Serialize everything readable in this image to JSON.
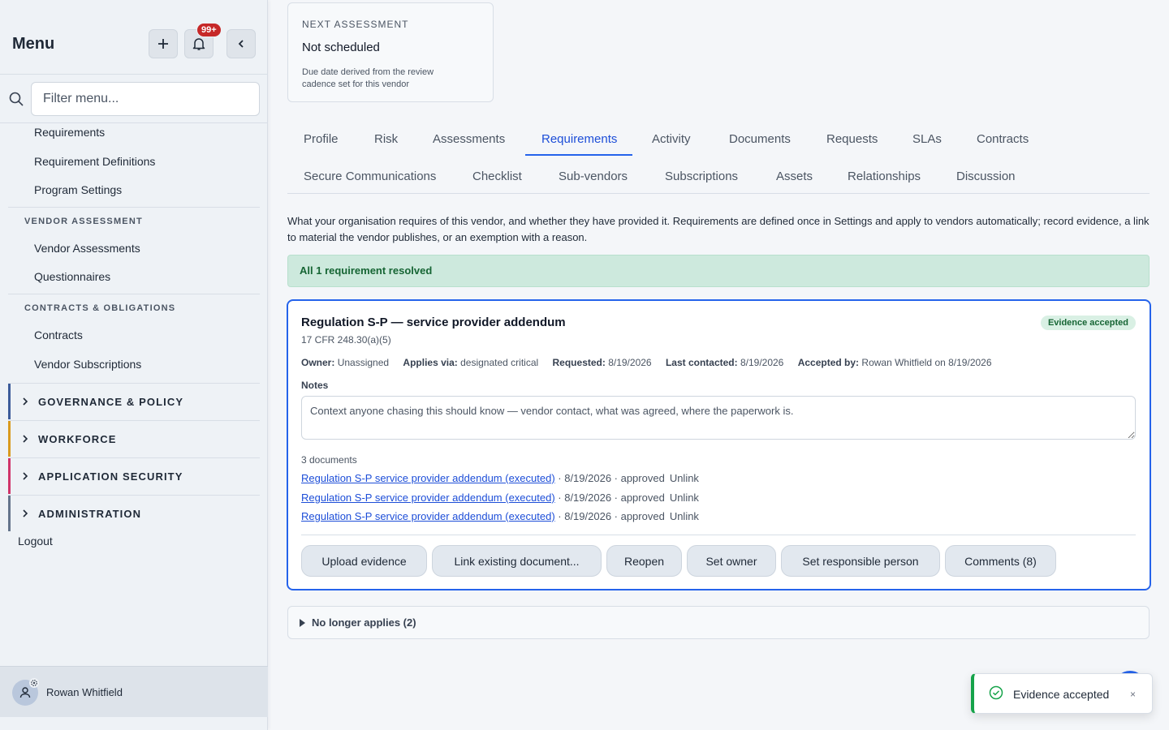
{
  "sidebar": {
    "title": "Menu",
    "notification_count": "99+",
    "filter_placeholder": "Filter menu...",
    "top_items": [
      "Requirements",
      "Requirement Definitions",
      "Program Settings"
    ],
    "sections": [
      {
        "label": "VENDOR ASSESSMENT",
        "items": [
          "Vendor Assessments",
          "Questionnaires"
        ]
      },
      {
        "label": "CONTRACTS & OBLIGATIONS",
        "items": [
          "Contracts",
          "Vendor Subscriptions"
        ]
      }
    ],
    "groups": [
      {
        "label": "GOVERNANCE & POLICY",
        "color": "#3b5b9a"
      },
      {
        "label": "WORKFORCE",
        "color": "#d99a1e"
      },
      {
        "label": "APPLICATION SECURITY",
        "color": "#d0346a"
      },
      {
        "label": "ADMINISTRATION",
        "color": "#64748b"
      }
    ],
    "logout": "Logout",
    "user_name": "Rowan Whitfield"
  },
  "next_assessment": {
    "label": "NEXT ASSESSMENT",
    "value": "Not scheduled",
    "note": "Due date derived from the review cadence set for this vendor"
  },
  "tabs": {
    "row1": [
      "Profile",
      "Risk",
      "Assessments",
      "Requirements",
      "Activity",
      "Documents",
      "Requests",
      "SLAs",
      "Contracts"
    ],
    "row2": [
      "Secure Communications",
      "Checklist",
      "Sub-vendors",
      "Subscriptions",
      "Assets",
      "Relationships",
      "Discussion"
    ],
    "active": "Requirements"
  },
  "description": "What your organisation requires of this vendor, and whether they have provided it. Requirements are defined once in Settings and apply to vendors automatically; record evidence, a link to material the vendor publishes, or an exemption with a reason.",
  "resolved_banner": "All 1 requirement resolved",
  "requirement": {
    "title": "Regulation S-P — service provider addendum",
    "citation": "17 CFR 248.30(a)(5)",
    "status": "Evidence accepted",
    "meta": {
      "owner_label": "Owner:",
      "owner": "Unassigned",
      "applies_label": "Applies via:",
      "applies": "designated critical",
      "requested_label": "Requested:",
      "requested": "8/19/2026",
      "contacted_label": "Last contacted:",
      "contacted": "8/19/2026",
      "accepted_label": "Accepted by:",
      "accepted": "Rowan Whitfield on 8/19/2026"
    },
    "notes_label": "Notes",
    "notes_placeholder": "Context anyone chasing this should know — vendor contact, what was agreed, where the paperwork is.",
    "documents_count": "3 documents",
    "documents": [
      {
        "name": "Regulation S-P service provider addendum (executed)",
        "info": " · 8/19/2026 · approved",
        "action": "Unlink"
      },
      {
        "name": "Regulation S-P service provider addendum (executed)",
        "info": " · 8/19/2026 · approved",
        "action": "Unlink"
      },
      {
        "name": "Regulation S-P service provider addendum (executed)",
        "info": " · 8/19/2026 · approved",
        "action": "Unlink"
      }
    ],
    "buttons": [
      "Upload evidence",
      "Link existing document...",
      "Reopen",
      "Set owner",
      "Set responsible person",
      "Comments (8)"
    ]
  },
  "no_longer_applies": "No longer applies (2)",
  "toast": {
    "text": "Evidence accepted",
    "close": "×"
  },
  "colors": {
    "accent": "#2563eb",
    "success": "#16a34a",
    "danger": "#c62828"
  }
}
